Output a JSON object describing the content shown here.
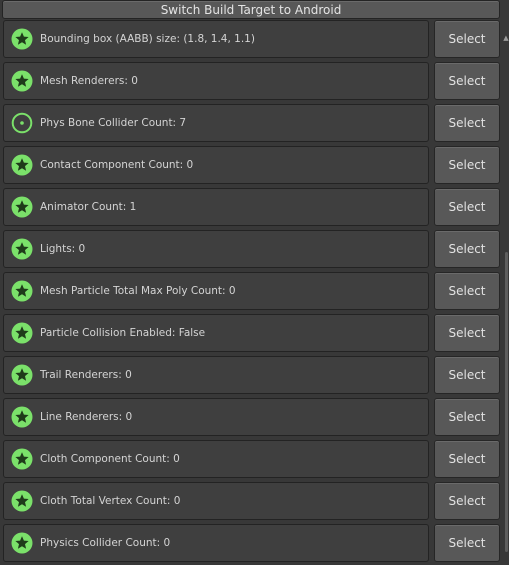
{
  "header": {
    "switch_build_label": "Switch Build Target to Android"
  },
  "colors": {
    "good_green": "#7be16a",
    "star_dark": "#1f3b1a"
  },
  "rows": [
    {
      "label": "Bounding box (AABB) size: (1.8, 1.4, 1.1)",
      "status": "star-icon",
      "button": "Select"
    },
    {
      "label": "Mesh Renderers: 0",
      "status": "star-icon",
      "button": "Select"
    },
    {
      "label": "Phys Bone Collider Count: 7",
      "status": "circle-dot-icon",
      "button": "Select"
    },
    {
      "label": "Contact Component Count: 0",
      "status": "star-icon",
      "button": "Select"
    },
    {
      "label": "Animator Count: 1",
      "status": "star-icon",
      "button": "Select"
    },
    {
      "label": "Lights: 0",
      "status": "star-icon",
      "button": "Select"
    },
    {
      "label": "Mesh Particle Total Max Poly Count: 0",
      "status": "star-icon",
      "button": "Select"
    },
    {
      "label": "Particle Collision Enabled: False",
      "status": "star-icon",
      "button": "Select"
    },
    {
      "label": "Trail Renderers: 0",
      "status": "star-icon",
      "button": "Select"
    },
    {
      "label": "Line Renderers: 0",
      "status": "star-icon",
      "button": "Select"
    },
    {
      "label": "Cloth Component Count: 0",
      "status": "star-icon",
      "button": "Select"
    },
    {
      "label": "Cloth Total Vertex Count: 0",
      "status": "star-icon",
      "button": "Select"
    },
    {
      "label": "Physics Collider Count: 0",
      "status": "star-icon",
      "button": "Select"
    }
  ]
}
